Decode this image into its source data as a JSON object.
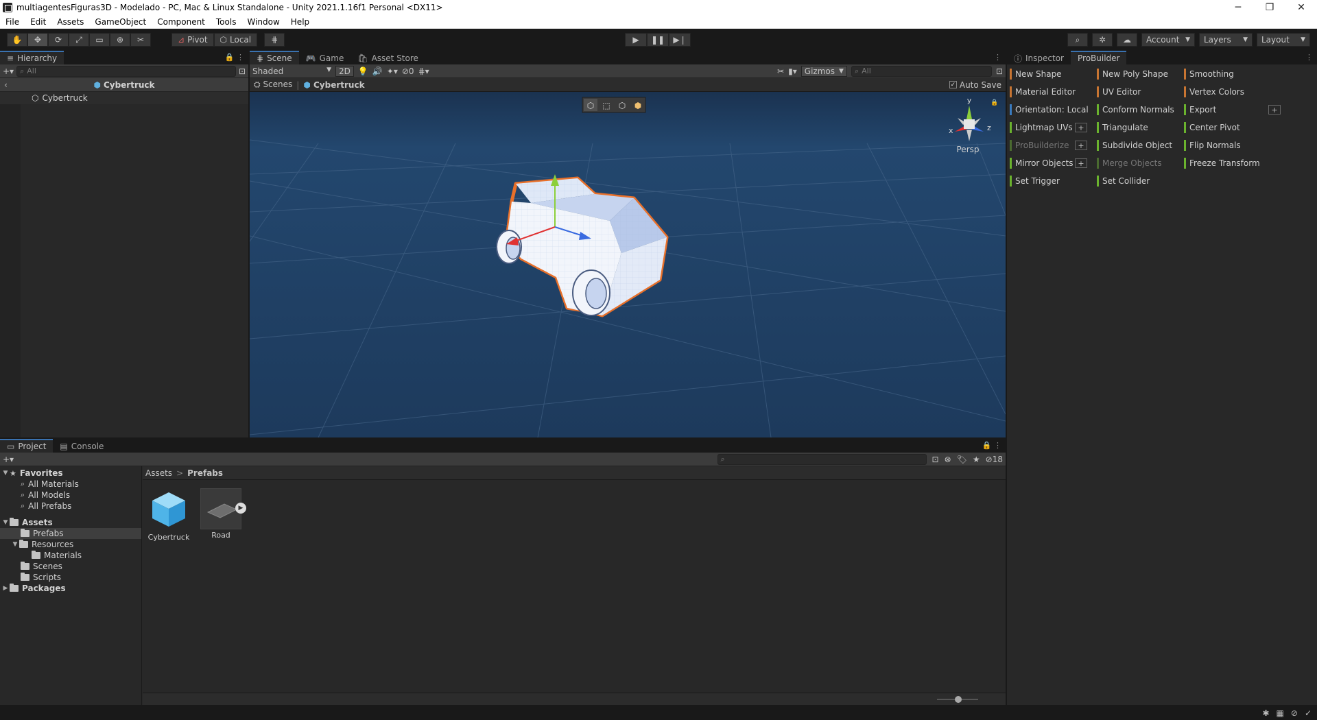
{
  "window": {
    "title": "multiagentesFiguras3D - Modelado - PC, Mac & Linux Standalone - Unity 2021.1.16f1 Personal <DX11>",
    "minimize": "─",
    "maximize": "❐",
    "close": "✕"
  },
  "menu": [
    "File",
    "Edit",
    "Assets",
    "GameObject",
    "Component",
    "Tools",
    "Window",
    "Help"
  ],
  "toolbar": {
    "pivot": "Pivot",
    "local": "Local",
    "account": "Account",
    "layers": "Layers",
    "layout": "Layout"
  },
  "hierarchy": {
    "tab": "Hierarchy",
    "search_placeholder": "All",
    "header": "Cybertruck",
    "items": [
      "Cybertruck"
    ]
  },
  "scene": {
    "tabs": [
      "Scene",
      "Game",
      "Asset Store"
    ],
    "shading": "Shaded",
    "mode_2d": "2D",
    "hidden_count": "0",
    "gizmos": "Gizmos",
    "search_placeholder": "All",
    "breadcrumb": [
      "Scenes",
      "Cybertruck"
    ],
    "autosave": "Auto Save",
    "persp": "Persp",
    "axes": {
      "x": "x",
      "y": "y",
      "z": "z"
    }
  },
  "inspector": {
    "tabs": [
      "Inspector",
      "ProBuilder"
    ],
    "probuilder_items": [
      {
        "label": "New Shape",
        "color": "#c87532",
        "plus": false,
        "disabled": false
      },
      {
        "label": "New Poly Shape",
        "color": "#c87532",
        "plus": false,
        "disabled": false
      },
      {
        "label": "Smoothing",
        "color": "#c87532",
        "plus": false,
        "disabled": false
      },
      {
        "label": "Material Editor",
        "color": "#c87532",
        "plus": false,
        "disabled": false
      },
      {
        "label": "UV Editor",
        "color": "#c87532",
        "plus": false,
        "disabled": false
      },
      {
        "label": "Vertex Colors",
        "color": "#c87532",
        "plus": false,
        "disabled": false
      },
      {
        "label": "Orientation: Local",
        "color": "#3a7bbf",
        "plus": false,
        "disabled": false
      },
      {
        "label": "Conform Normals",
        "color": "#6bb32e",
        "plus": false,
        "disabled": false
      },
      {
        "label": "Export",
        "color": "#6bb32e",
        "plus": true,
        "disabled": false
      },
      {
        "label": "Lightmap UVs",
        "color": "#6bb32e",
        "plus": true,
        "disabled": false
      },
      {
        "label": "Triangulate",
        "color": "#6bb32e",
        "plus": false,
        "disabled": false
      },
      {
        "label": "Center Pivot",
        "color": "#6bb32e",
        "plus": false,
        "disabled": false
      },
      {
        "label": "ProBuilderize",
        "color": "#4a6a30",
        "plus": true,
        "disabled": true
      },
      {
        "label": "Subdivide Object",
        "color": "#6bb32e",
        "plus": false,
        "disabled": false
      },
      {
        "label": "Flip Normals",
        "color": "#6bb32e",
        "plus": false,
        "disabled": false
      },
      {
        "label": "Mirror Objects",
        "color": "#6bb32e",
        "plus": true,
        "disabled": false
      },
      {
        "label": "Merge Objects",
        "color": "#4a6a30",
        "plus": false,
        "disabled": true
      },
      {
        "label": "Freeze Transform",
        "color": "#6bb32e",
        "plus": false,
        "disabled": false
      },
      {
        "label": "Set Trigger",
        "color": "#6bb32e",
        "plus": false,
        "disabled": false
      },
      {
        "label": "Set Collider",
        "color": "#6bb32e",
        "plus": false,
        "disabled": false
      }
    ]
  },
  "project": {
    "tabs": [
      "Project",
      "Console"
    ],
    "hidden_count": "18",
    "breadcrumb": [
      "Assets",
      "Prefabs"
    ],
    "tree": {
      "favorites": "Favorites",
      "fav_items": [
        "All Materials",
        "All Models",
        "All Prefabs"
      ],
      "assets": "Assets",
      "prefabs": "Prefabs",
      "resources": "Resources",
      "materials": "Materials",
      "scenes": "Scenes",
      "scripts": "Scripts",
      "packages": "Packages"
    },
    "assets": [
      "Cybertruck",
      "Road"
    ]
  },
  "colors": {
    "accent": "#3a72b0",
    "selection_outline": "#e8702a",
    "scene_bg": "#1e3a5a"
  }
}
